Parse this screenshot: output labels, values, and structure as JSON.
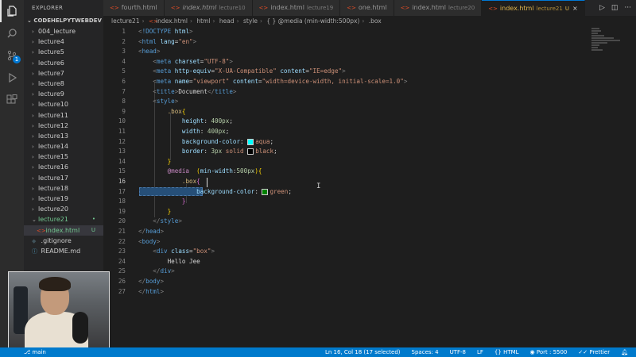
{
  "sidebar": {
    "title": "EXPLORER",
    "root": "CODEHELPYTWEBDEV",
    "folders": [
      "004_lecture",
      "lecture4",
      "lecture5",
      "lecture6",
      "lecture7",
      "lecture8",
      "lecture9",
      "lecture10",
      "lecture11",
      "lecture12",
      "lecture13",
      "lecture14",
      "lecture15",
      "lecture16",
      "lecture17",
      "lecture18",
      "lecture19",
      "lecture20"
    ],
    "open_folder": "lecture21",
    "open_folder_status": "•",
    "open_file": "index.html",
    "open_file_status": "U",
    "root_files": [
      ".gitignore",
      "README.md"
    ]
  },
  "tabs": [
    {
      "label": "fourth.html",
      "sub": ""
    },
    {
      "label": "index.html",
      "sub": "lecture10"
    },
    {
      "label": "index.html",
      "sub": "lecture19"
    },
    {
      "label": "one.html",
      "sub": ""
    },
    {
      "label": "index.html",
      "sub": "lecture20"
    },
    {
      "label": "index.html",
      "sub": "lecture21",
      "mod": "U",
      "close": "×"
    }
  ],
  "breadcrumb": [
    "lecture21",
    "index.html",
    "html",
    "head",
    "style",
    "{ } @media (min-width:500px)",
    ".box"
  ],
  "editor": {
    "current_line": "16"
  },
  "status": {
    "branch": "main",
    "position": "Ln 16, Col 18 (17 selected)",
    "spaces": "Spaces: 4",
    "encoding": "UTF-8",
    "eol": "LF",
    "language": "HTML",
    "port": "Port : 5500",
    "formatter": "Prettier"
  },
  "colors": {
    "accent": "#007acc",
    "modified": "#e0b44a",
    "untracked": "#73c991"
  },
  "icons": [
    "explorer-icon",
    "search-icon",
    "source-control-icon",
    "run-debug-icon",
    "extensions-icon",
    "run-icon",
    "split-editor-icon",
    "more-icon"
  ]
}
